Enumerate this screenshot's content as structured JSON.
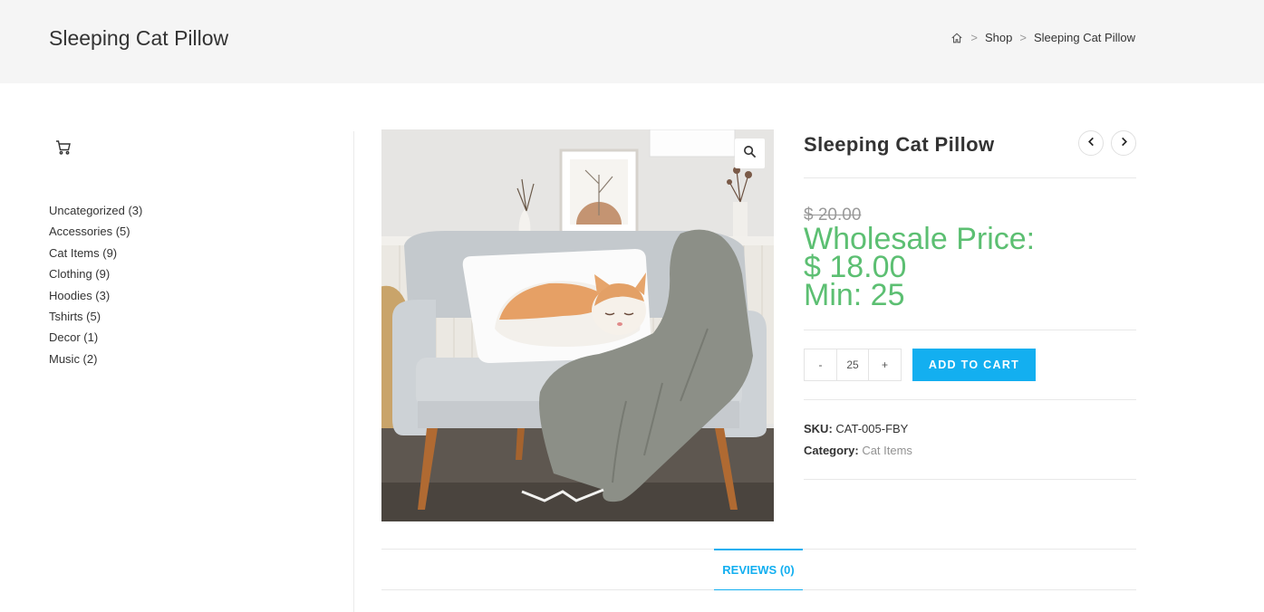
{
  "header": {
    "page_title": "Sleeping Cat Pillow",
    "breadcrumb": {
      "home_icon": "home-icon",
      "shop": "Shop",
      "current": "Sleeping Cat Pillow",
      "separator": ">"
    }
  },
  "sidebar": {
    "cart_icon": "cart-icon",
    "categories": [
      {
        "label": "Uncategorized (3)"
      },
      {
        "label": "Accessories (5)"
      },
      {
        "label": "Cat Items (9)"
      },
      {
        "label": "Clothing (9)"
      },
      {
        "label": "Hoodies (3)"
      },
      {
        "label": "Tshirts (5)"
      },
      {
        "label": "Decor (1)"
      },
      {
        "label": "Music (2)"
      }
    ]
  },
  "product": {
    "title": "Sleeping Cat Pillow",
    "old_price": "$ 20.00",
    "wholesale_label": "Wholesale Price:",
    "wholesale_price": "$ 18.00",
    "wholesale_min": "Min: 25",
    "quantity": {
      "minus": "-",
      "value": "25",
      "plus": "+"
    },
    "add_to_cart": "ADD TO CART",
    "sku_label": "SKU:",
    "sku_value": "CAT-005-FBY",
    "category_label": "Category:",
    "category_value": "Cat Items"
  },
  "tabs": {
    "reviews": "REVIEWS (0)"
  },
  "colors": {
    "accent": "#13aff0",
    "wholesale_green": "#5cbf72",
    "header_bg": "#f5f5f5"
  }
}
